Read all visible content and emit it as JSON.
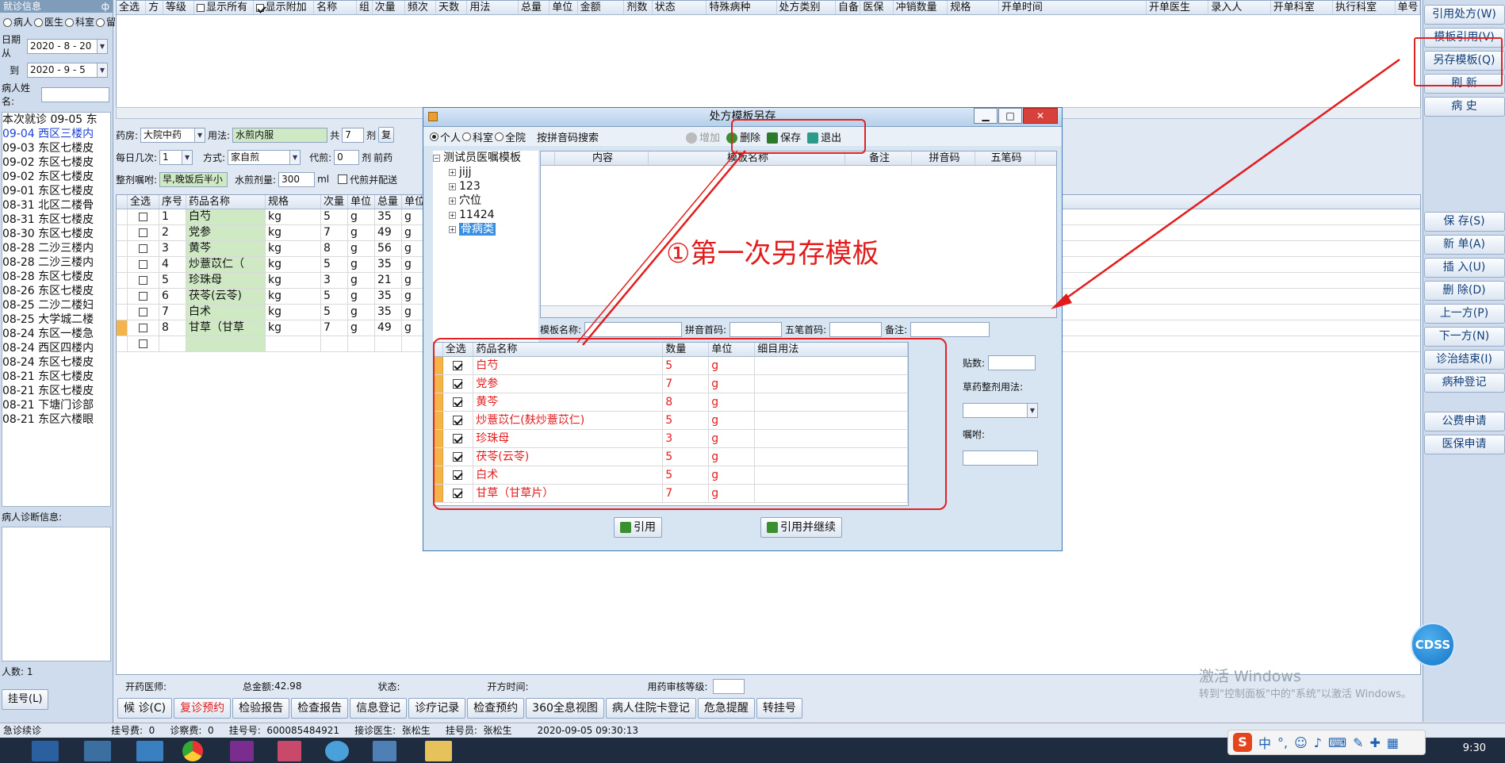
{
  "left_panel": {
    "title": "就诊信息",
    "pin": "ф",
    "radio_patient": "病人",
    "radio_doctor": "医生",
    "radio_room": "科室",
    "radio_leave": "留",
    "date_from_label": "日期从",
    "date_from": "2020 - 8 - 20",
    "date_to_label": "到",
    "date_to": "2020 - 9 - 5",
    "patient_name_label": "病人姓名:",
    "visit_header": "本次就诊 09-05 东",
    "visits": [
      "09-04 西区三楼内",
      "09-03 东区七楼皮",
      "09-02 东区七楼皮",
      "09-02 东区七楼皮",
      "09-01 东区七楼皮",
      "08-31 北区二楼骨",
      "08-31 东区七楼皮",
      "08-30 东区七楼皮",
      "08-28 二沙三楼内",
      "08-28 二沙三楼内",
      "08-28 东区七楼皮",
      "08-26 东区七楼皮",
      "08-25 二沙二楼妇",
      "08-25 大学城二楼",
      "08-24 东区一楼急",
      "08-24 西区四楼内",
      "08-24 东区七楼皮",
      "08-21 东区七楼皮",
      "08-21 东区七楼皮",
      "08-21 下塘门诊部",
      "08-21 东区六楼眼"
    ],
    "diag_label": "病人诊断信息:",
    "count_label": "人数: 1",
    "reg_button": "挂号(L)"
  },
  "top_grid": {
    "headers": [
      "全选",
      "方",
      "等级",
      "显示所有",
      "显示附加",
      "名称",
      "组",
      "次量",
      "频次",
      "天数",
      "用法",
      "总量",
      "单位",
      "金额",
      "剂数",
      "状态",
      "特殊病种",
      "处方类别",
      "自备",
      "医保",
      "冲销数量",
      "规格",
      "开单时间",
      "开单医生",
      "录入人",
      "开单科室",
      "执行科室",
      "单号"
    ]
  },
  "herb_form": {
    "pharmacy_label": "药房:",
    "pharmacy": "大院中药",
    "usage_label": "用法:",
    "usage": "水煎内服",
    "total_label": "共",
    "doses": "7",
    "dose_unit": "剂",
    "copy_btn": "复",
    "daily_label": "每日几次:",
    "daily": "1",
    "method_label": "方式:",
    "method": "家自煎",
    "boil_label": "代煎:",
    "boil": "0",
    "boil_unit": "剂",
    "pre_label": "前药",
    "advice_label": "整剂嘱咐:",
    "advice": "早,晚饭后半小",
    "water_label": "水煎剂量:",
    "water": "300",
    "water_unit": "ml",
    "other_label": "代煎并配送"
  },
  "herb_grid": {
    "headers": [
      "全选",
      "序号",
      "药品名称",
      "规格",
      "次量",
      "单位",
      "总量",
      "单位"
    ],
    "rows": [
      [
        "1",
        "白芍",
        "kg",
        "5",
        "g",
        "35",
        "g"
      ],
      [
        "2",
        "党参",
        "kg",
        "7",
        "g",
        "49",
        "g"
      ],
      [
        "3",
        "黄芩",
        "kg",
        "8",
        "g",
        "56",
        "g"
      ],
      [
        "4",
        "炒薏苡仁（",
        "kg",
        "5",
        "g",
        "35",
        "g"
      ],
      [
        "5",
        "珍珠母",
        "kg",
        "3",
        "g",
        "21",
        "g"
      ],
      [
        "6",
        "茯苓(云苓)",
        "kg",
        "5",
        "g",
        "35",
        "g"
      ],
      [
        "7",
        "白术",
        "kg",
        "5",
        "g",
        "35",
        "g"
      ],
      [
        "8",
        "甘草（甘草",
        "kg",
        "7",
        "g",
        "49",
        "g"
      ]
    ]
  },
  "dialog": {
    "title": "处方模板另存",
    "radio_personal": "个人",
    "radio_dept": "科室",
    "radio_all": "全院",
    "search_label": "按拼音码搜索",
    "btn_add": "增加",
    "btn_delete": "删除",
    "btn_save": "保存",
    "btn_exit": "退出",
    "tree": {
      "root": "测试员医嘱模板",
      "children": [
        "jijj",
        "123",
        "穴位",
        "11424",
        "骨病类"
      ]
    },
    "tpl_headers": [
      "内容",
      "模板名称",
      "备注",
      "拼音码",
      "五笔码"
    ],
    "name_label": "模板名称:",
    "pinyin_label": "拼音首码:",
    "wubi_label": "五笔首码:",
    "note_label": "备注:",
    "drug_headers": [
      "全选",
      "药品名称",
      "数量",
      "单位",
      "细目用法"
    ],
    "drugs": [
      [
        "白芍",
        "5",
        "g"
      ],
      [
        "党参",
        "7",
        "g"
      ],
      [
        "黄芩",
        "8",
        "g"
      ],
      [
        "炒薏苡仁(麸炒薏苡仁)",
        "5",
        "g"
      ],
      [
        "珍珠母",
        "3",
        "g"
      ],
      [
        "茯苓(云苓)",
        "5",
        "g"
      ],
      [
        "白术",
        "5",
        "g"
      ],
      [
        "甘草（甘草片）",
        "7",
        "g"
      ]
    ],
    "side_tie_label": "贴数:",
    "side_usage_label": "草药整剂用法:",
    "side_advice_label": "嘱咐:",
    "btn_apply": "引用",
    "btn_apply_continue": "引用并继续"
  },
  "annotation": "①第一次另存模板",
  "right_buttons": [
    "引用处方(W)",
    "模板引用(V)",
    "另存模板(Q)",
    "刷 新",
    "病 史",
    "保 存(S)",
    "新 单(A)",
    "插 入(U)",
    "删 除(D)",
    "上一方(P)",
    "下一方(N)",
    "诊治结束(I)",
    "病种登记",
    "公费申请",
    "医保申请"
  ],
  "status_bar": {
    "doctor_label": "开药医师:",
    "total_label": "总金额:",
    "total": "42.98",
    "state_label": "状态:",
    "rx_time_label": "开方时间:",
    "audit_label": "用药审核等级:"
  },
  "bottom_buttons": [
    "候 诊(C)",
    "复诊预约",
    "检验报告",
    "检查报告",
    "信息登记",
    "诊疗记录",
    "检查预约",
    "360全息视图",
    "病人住院卡登记",
    "危急提醒",
    "转挂号"
  ],
  "info_bar": {
    "left": "急诊续诊",
    "text": "挂号费:  0     诊察费:  0     挂号号:  600085484921     接诊医生:  张松生     挂号员:  张松生",
    "datetime": "2020-09-05 09:30:13"
  },
  "watermark": {
    "line1": "激活 Windows",
    "line2": "转到\"控制面板\"中的\"系统\"以激活 Windows。"
  },
  "cdss": "CDSS",
  "taskbar": {
    "time": "9:30",
    "ime": "中"
  }
}
